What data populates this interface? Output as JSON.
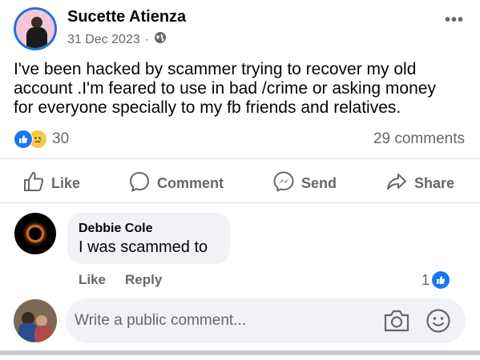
{
  "post": {
    "author": "Sucette Atienza",
    "date": "31 Dec 2023",
    "date_sep": "·",
    "more_label": "•••",
    "text": "I've been hacked by scammer trying to recover my old\naccount .I'm feared to use in bad  /crime or asking money\nfor everyone specially to my fb friends and relatives.",
    "reaction_count": "30",
    "comments_count": "29 comments"
  },
  "actions": {
    "like": "Like",
    "comment": "Comment",
    "send": "Send",
    "share": "Share"
  },
  "comment": {
    "author": "Debbie Cole",
    "text": "I was scammed to",
    "like_label": "Like",
    "reply_label": "Reply",
    "like_count": "1"
  },
  "composer": {
    "placeholder": "Write a public comment..."
  },
  "colors": {
    "accent": "#1877f2",
    "secondary_text": "#65676b",
    "bubble": "#f0f2f5"
  }
}
